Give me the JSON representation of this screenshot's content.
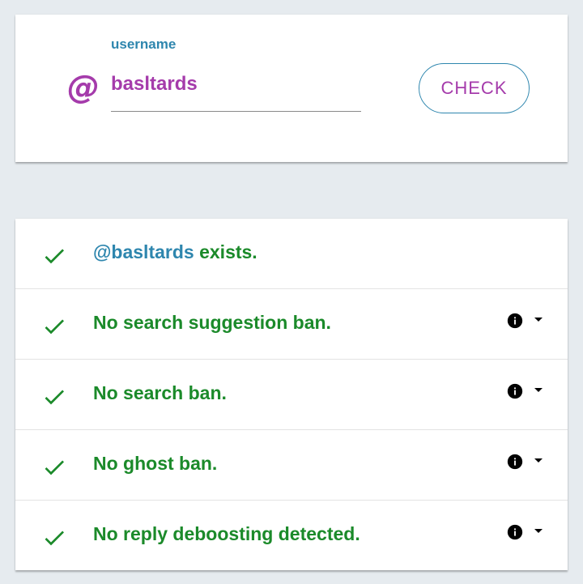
{
  "search": {
    "label": "username",
    "value": "basltards",
    "at_symbol": "@",
    "button_label": "CHECK"
  },
  "results": {
    "exists": {
      "handle": "@basltards",
      "text": " exists.",
      "status_icon": "check-icon"
    },
    "items": [
      {
        "label": "No search suggestion ban.",
        "status_icon": "check-icon",
        "has_info": true
      },
      {
        "label": "No search ban.",
        "status_icon": "check-icon",
        "has_info": true
      },
      {
        "label": "No ghost ban.",
        "status_icon": "check-icon",
        "has_info": true
      },
      {
        "label": "No reply deboosting detected.",
        "status_icon": "check-icon",
        "has_info": true
      }
    ]
  },
  "colors": {
    "background": "#e6ebef",
    "accent_purple": "#a53bab",
    "accent_blue": "#2e86ae",
    "success_green": "#1b8a2a"
  }
}
